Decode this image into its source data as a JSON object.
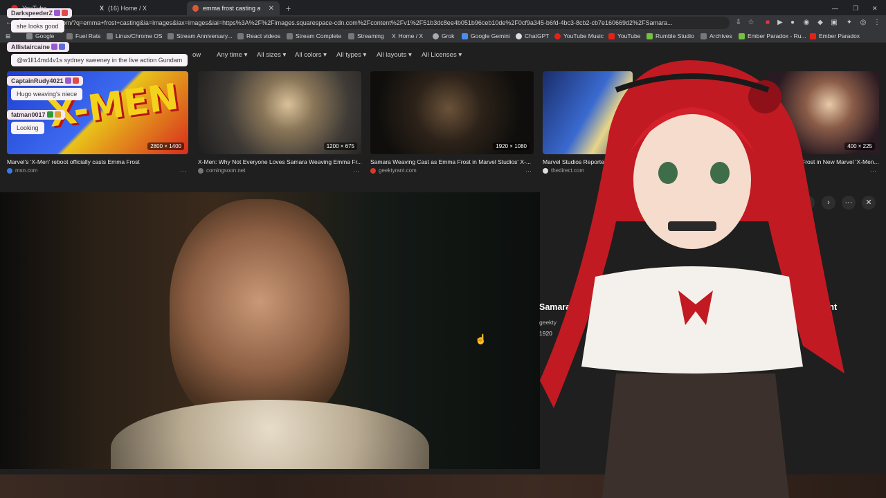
{
  "tabs": [
    {
      "label": "YouTube",
      "active": false
    },
    {
      "label": "(16) Home / X",
      "active": false
    },
    {
      "label": "emma frost casting at Du",
      "active": true
    }
  ],
  "address": {
    "url": "duckgo.com/?q=emma+frost+casting&ia=images&iax=images&iai=https%3A%2F%2Fimages.squarespace-cdn.com%2Fcontent%2Fv1%2F51b3dc8ee4b051b96ceb10de%2F0cf9a345-b6fd-4bc3-8cb2-cb7e160669d2%2FSamara..."
  },
  "bookmarks": [
    "Google",
    "Fuel Rats",
    "Linux/Chrome OS",
    "Stream Anniversary...",
    "React videos",
    "Stream Complete",
    "Streaming",
    "Home / X",
    "Grok",
    "Google Gemini",
    "ChatGPT",
    "YouTube Music",
    "YouTube",
    "Rumble Studio",
    "Archives",
    "Ember Paradox - Ru...",
    "Ember Paradox"
  ],
  "filters": [
    "ow",
    "Any time",
    "All sizes",
    "All colors",
    "All types",
    "All layouts",
    "All Licenses"
  ],
  "results": [
    {
      "caption": "Marvel's 'X-Men' reboot officially casts Emma Frost",
      "source": "msn.com",
      "dims": "2800 × 1400"
    },
    {
      "caption": "X-Men: Why Not Everyone Loves Samara Weaving Emma Fr...",
      "source": "comingsoon.net",
      "dims": "1200 × 675"
    },
    {
      "caption": "Samara Weaving Cast as Emma Frost in Marvel Studios' X-...",
      "source": "geektyrant.com",
      "dims": "1920 × 1080"
    },
    {
      "caption": "Marvel Studios Reported",
      "source": "thedirect.com",
      "dims": ""
    },
    {
      "caption": "Frost in New Marvel 'X-Men...",
      "source": "",
      "dims": "400 × 225"
    }
  ],
  "detail": {
    "title": "Samara",
    "title_end": "ekTyrant",
    "source": "geekty",
    "dims": "1920"
  },
  "chat": [
    {
      "user": "DarkspeederZ",
      "msg": "she looks good"
    },
    {
      "user": "Allistaircaine",
      "msg": "@w1ll14md4v1s sydney sweeney in the live action Gundam"
    },
    {
      "user": "CaptainRudy4021",
      "msg": "Hugo weaving's niece"
    },
    {
      "user": "fatman0017",
      "msg": "Looking"
    }
  ],
  "colors": {
    "accent": "#d33a3a",
    "chat_bg": "#f3e8f2"
  }
}
